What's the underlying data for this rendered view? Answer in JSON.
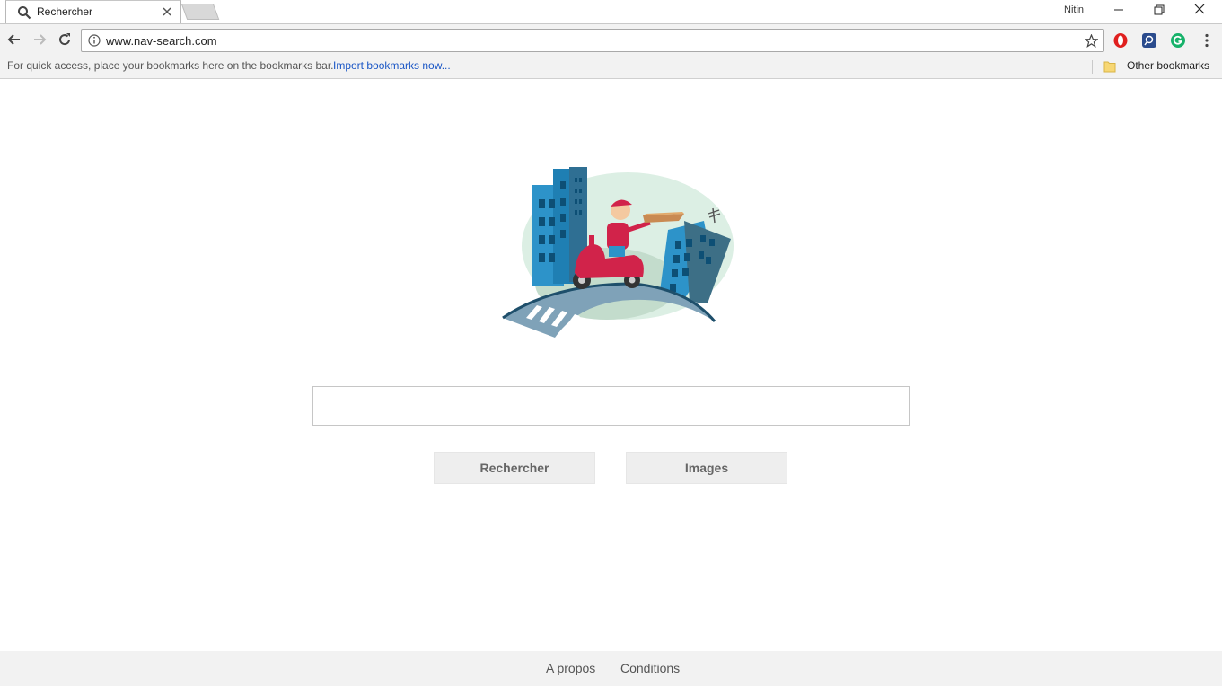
{
  "browser": {
    "tab": {
      "title": "Rechercher"
    },
    "profile_name": "Nitin",
    "address": {
      "url": "www.nav-search.com"
    },
    "bookmarks_bar": {
      "hint": "For quick access, place your bookmarks here on the bookmarks bar.",
      "import_link": "Import bookmarks now...",
      "other_bookmarks": "Other bookmarks"
    },
    "icons": [
      "search-icon",
      "close-icon",
      "back-icon",
      "forward-icon",
      "reload-icon",
      "info-icon",
      "star-icon",
      "opera-icon",
      "extension-icon",
      "grammarly-icon",
      "menu-icon",
      "folder-icon"
    ],
    "extension_colors": {
      "opera": "#e0201f",
      "ext2": "#2a4b8d",
      "grammarly": "#17b26a"
    }
  },
  "page": {
    "search": {
      "value": "",
      "placeholder": ""
    },
    "buttons": {
      "search": "Rechercher",
      "images": "Images"
    },
    "footer": {
      "about": "A propos",
      "conditions": "Conditions"
    }
  }
}
